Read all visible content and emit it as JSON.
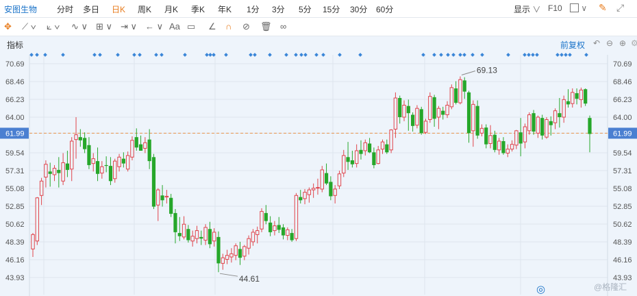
{
  "header": {
    "stock_name": "安图生物",
    "periods": [
      "分时",
      "多日",
      "日K",
      "周K",
      "月K",
      "季K",
      "年K",
      "1分",
      "3分",
      "5分",
      "15分",
      "30分",
      "60分"
    ],
    "active_period": "日K",
    "display_label": "显示",
    "f10_label": "F10"
  },
  "toolbar": {
    "text_tool_label": "Aa"
  },
  "indicator": {
    "label": "指标",
    "adjust_label": "前复权"
  },
  "watermark": "@格隆汇",
  "colors": {
    "up": "#e0434a",
    "down": "#26a72a",
    "ref_line": "#e8934a",
    "ref_bg": "#4a7fd1",
    "accent": "#1a73c9",
    "active": "#e87c1d"
  },
  "chart_data": {
    "type": "candlestick",
    "y_ticks": [
      "70.69",
      "68.46",
      "66.23",
      "64.00",
      "61.99",
      "59.54",
      "57.31",
      "55.08",
      "52.85",
      "50.62",
      "48.39",
      "46.16",
      "43.93"
    ],
    "ylim": [
      43.93,
      70.69
    ],
    "current_price": 61.99,
    "annotations": {
      "high": "69.13",
      "low": "44.61"
    },
    "ohlc": [
      [
        47.5,
        49.5,
        46.5,
        49.3
      ],
      [
        48.5,
        54.0,
        48.0,
        53.9
      ],
      [
        54.2,
        56.4,
        53.0,
        56.0
      ],
      [
        56.5,
        58.6,
        55.2,
        58.1
      ],
      [
        57.2,
        58.3,
        55.3,
        56.9
      ],
      [
        56.8,
        58.0,
        56.0,
        57.6
      ],
      [
        57.4,
        59.0,
        55.2,
        57.0
      ],
      [
        56.0,
        59.5,
        55.5,
        58.3
      ],
      [
        58.2,
        59.8,
        56.5,
        57.4
      ],
      [
        57.5,
        61.5,
        56.0,
        61.0
      ],
      [
        61.2,
        64.0,
        58.8,
        61.8
      ],
      [
        61.5,
        62.5,
        60.3,
        61.1
      ],
      [
        61.4,
        62.1,
        59.5,
        60.0
      ],
      [
        60.5,
        61.5,
        57.5,
        58.0
      ],
      [
        58.2,
        59.5,
        57.2,
        58.8
      ],
      [
        58.5,
        60.2,
        56.0,
        56.9
      ],
      [
        57.0,
        58.5,
        56.3,
        57.8
      ],
      [
        58.0,
        59.1,
        57.1,
        57.9
      ],
      [
        57.9,
        59.0,
        55.5,
        56.0
      ],
      [
        56.3,
        58.8,
        55.8,
        58.5
      ],
      [
        57.8,
        59.4,
        57.2,
        59.0
      ],
      [
        58.8,
        59.6,
        57.7,
        58.2
      ],
      [
        57.5,
        59.7,
        57.2,
        59.2
      ],
      [
        59.0,
        61.6,
        58.6,
        61.1
      ],
      [
        61.5,
        62.6,
        59.8,
        60.2
      ],
      [
        60.6,
        61.7,
        59.8,
        59.8
      ],
      [
        60.1,
        61.5,
        59.5,
        60.8
      ],
      [
        61.2,
        62.5,
        57.5,
        58.5
      ],
      [
        59.0,
        59.4,
        52.5,
        52.8
      ],
      [
        53.0,
        55.1,
        51.0,
        54.9
      ],
      [
        54.2,
        55.5,
        52.8,
        53.6
      ],
      [
        54.0,
        54.9,
        53.2,
        54.1
      ],
      [
        53.9,
        54.4,
        51.5,
        51.9
      ],
      [
        52.0,
        52.5,
        48.2,
        49.6
      ],
      [
        49.5,
        51.5,
        48.5,
        49.1
      ],
      [
        49.0,
        51.6,
        48.7,
        50.6
      ],
      [
        50.0,
        50.5,
        48.3,
        48.6
      ],
      [
        48.5,
        49.8,
        47.8,
        49.1
      ],
      [
        48.8,
        50.4,
        48.2,
        49.8
      ],
      [
        49.0,
        49.8,
        48.0,
        48.8
      ],
      [
        48.6,
        50.6,
        48.0,
        50.2
      ],
      [
        50.0,
        50.9,
        47.6,
        48.1
      ],
      [
        48.5,
        50.1,
        47.8,
        49.6
      ],
      [
        49.0,
        49.7,
        44.6,
        45.7
      ],
      [
        45.7,
        46.9,
        44.9,
        46.4
      ],
      [
        46.2,
        47.4,
        45.6,
        46.7
      ],
      [
        46.5,
        47.6,
        45.8,
        46.9
      ],
      [
        46.7,
        48.2,
        46.1,
        47.9
      ],
      [
        47.5,
        48.4,
        45.5,
        46.4
      ],
      [
        46.6,
        48.0,
        46.1,
        47.8
      ],
      [
        47.6,
        49.2,
        46.8,
        48.8
      ],
      [
        48.4,
        50.0,
        47.9,
        49.6
      ],
      [
        49.3,
        50.3,
        48.2,
        49.8
      ],
      [
        50.0,
        52.6,
        49.6,
        52.2
      ],
      [
        52.0,
        53.0,
        50.6,
        51.0
      ],
      [
        50.8,
        51.6,
        49.1,
        49.6
      ],
      [
        49.8,
        51.0,
        49.2,
        50.4
      ],
      [
        50.5,
        51.5,
        49.5,
        49.9
      ],
      [
        50.2,
        50.6,
        48.7,
        49.2
      ],
      [
        49.2,
        50.2,
        48.6,
        49.9
      ],
      [
        49.5,
        50.0,
        48.4,
        48.6
      ],
      [
        48.8,
        54.5,
        48.5,
        54.2
      ],
      [
        54.0,
        54.9,
        53.2,
        53.6
      ],
      [
        53.8,
        55.0,
        53.1,
        54.6
      ],
      [
        54.3,
        55.2,
        53.3,
        54.9
      ],
      [
        54.9,
        55.7,
        53.9,
        55.1
      ],
      [
        55.2,
        56.3,
        54.3,
        55.2
      ],
      [
        55.0,
        57.9,
        54.6,
        57.4
      ],
      [
        57.0,
        58.2,
        55.5,
        55.7
      ],
      [
        55.9,
        56.6,
        53.6,
        54.1
      ],
      [
        54.2,
        55.5,
        53.2,
        55.0
      ],
      [
        55.4,
        57.3,
        55.0,
        56.9
      ],
      [
        57.0,
        59.9,
        56.5,
        59.2
      ],
      [
        59.0,
        60.9,
        57.4,
        58.4
      ],
      [
        58.6,
        59.8,
        57.7,
        58.1
      ],
      [
        58.2,
        60.6,
        57.7,
        59.8
      ],
      [
        59.9,
        61.1,
        58.7,
        59.4
      ],
      [
        59.8,
        61.2,
        59.2,
        60.8
      ],
      [
        60.7,
        61.4,
        59.5,
        59.6
      ],
      [
        59.6,
        60.2,
        57.6,
        58.0
      ],
      [
        58.2,
        60.4,
        58.1,
        59.9
      ],
      [
        60.0,
        61.2,
        59.4,
        60.9
      ],
      [
        60.6,
        61.2,
        59.4,
        59.6
      ],
      [
        59.9,
        62.5,
        59.5,
        62.4
      ],
      [
        62.5,
        67.1,
        61.4,
        66.4
      ],
      [
        66.4,
        66.7,
        63.2,
        64.0
      ],
      [
        64.0,
        66.1,
        63.5,
        65.5
      ],
      [
        65.4,
        66.2,
        62.3,
        64.5
      ],
      [
        64.3,
        64.6,
        62.2,
        62.9
      ],
      [
        63.0,
        65.5,
        62.6,
        65.1
      ],
      [
        65.0,
        65.3,
        61.8,
        62.0
      ],
      [
        62.1,
        63.8,
        61.9,
        63.5
      ],
      [
        63.7,
        67.1,
        63.3,
        66.6
      ],
      [
        66.5,
        66.8,
        62.8,
        63.8
      ],
      [
        64.0,
        65.4,
        62.5,
        65.1
      ],
      [
        64.8,
        65.3,
        63.7,
        64.3
      ],
      [
        64.3,
        66.0,
        63.9,
        65.5
      ],
      [
        65.3,
        68.1,
        65.0,
        67.7
      ],
      [
        67.6,
        68.5,
        65.6,
        65.8
      ],
      [
        65.8,
        69.1,
        65.6,
        68.7
      ],
      [
        68.6,
        69.0,
        66.3,
        67.2
      ],
      [
        67.1,
        67.3,
        60.8,
        62.0
      ],
      [
        62.3,
        66.1,
        60.3,
        65.6
      ],
      [
        65.4,
        66.1,
        61.3,
        61.7
      ],
      [
        62.0,
        63.1,
        61.6,
        62.6
      ],
      [
        62.7,
        63.1,
        60.1,
        60.6
      ],
      [
        60.7,
        63.0,
        60.1,
        61.7
      ],
      [
        61.8,
        62.3,
        59.6,
        59.9
      ],
      [
        59.9,
        61.4,
        59.3,
        61.0
      ],
      [
        61.0,
        61.5,
        59.3,
        59.5
      ],
      [
        59.5,
        60.6,
        59.0,
        60.0
      ],
      [
        60.0,
        61.1,
        59.7,
        60.6
      ],
      [
        60.5,
        62.4,
        60.0,
        62.3
      ],
      [
        62.1,
        63.9,
        59.1,
        60.7
      ],
      [
        60.9,
        63.2,
        60.1,
        62.8
      ],
      [
        62.3,
        64.6,
        61.8,
        64.3
      ],
      [
        64.5,
        64.9,
        61.8,
        62.2
      ],
      [
        62.0,
        64.2,
        61.4,
        64.0
      ],
      [
        63.9,
        64.3,
        61.2,
        61.7
      ],
      [
        61.5,
        64.0,
        61.3,
        63.7
      ],
      [
        63.5,
        64.1,
        61.7,
        63.0
      ],
      [
        63.3,
        65.1,
        62.5,
        64.8
      ],
      [
        64.5,
        66.4,
        62.7,
        64.0
      ],
      [
        64.0,
        66.7,
        63.3,
        66.2
      ],
      [
        66.0,
        67.5,
        65.2,
        65.6
      ],
      [
        65.7,
        67.6,
        65.2,
        67.1
      ],
      [
        67.0,
        67.6,
        65.6,
        66.3
      ],
      [
        66.2,
        67.7,
        65.2,
        67.4
      ],
      [
        67.5,
        67.6,
        65.4,
        65.7
      ],
      [
        63.9,
        64.2,
        59.6,
        61.9
      ]
    ]
  }
}
